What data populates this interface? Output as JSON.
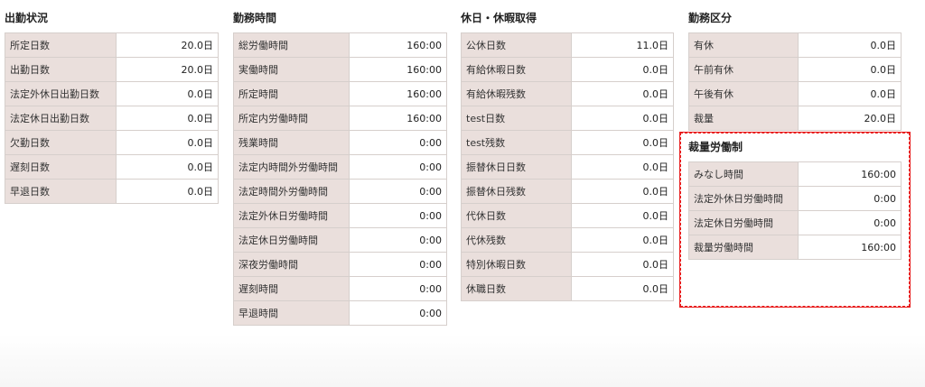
{
  "attendance": {
    "title": "出勤状況",
    "rows": [
      {
        "label": "所定日数",
        "value": "20.0日"
      },
      {
        "label": "出勤日数",
        "value": "20.0日"
      },
      {
        "label": "法定外休日出勤日数",
        "value": "0.0日"
      },
      {
        "label": "法定休日出勤日数",
        "value": "0.0日"
      },
      {
        "label": "欠勤日数",
        "value": "0.0日"
      },
      {
        "label": "遅刻日数",
        "value": "0.0日"
      },
      {
        "label": "早退日数",
        "value": "0.0日"
      }
    ]
  },
  "work_hours": {
    "title": "勤務時間",
    "rows": [
      {
        "label": "総労働時間",
        "value": "160:00"
      },
      {
        "label": "実働時間",
        "value": "160:00"
      },
      {
        "label": "所定時間",
        "value": "160:00"
      },
      {
        "label": "所定内労働時間",
        "value": "160:00"
      },
      {
        "label": "残業時間",
        "value": "0:00"
      },
      {
        "label": "法定内時間外労働時間",
        "value": "0:00"
      },
      {
        "label": "法定時間外労働時間",
        "value": "0:00"
      },
      {
        "label": "法定外休日労働時間",
        "value": "0:00"
      },
      {
        "label": "法定休日労働時間",
        "value": "0:00"
      },
      {
        "label": "深夜労働時間",
        "value": "0:00"
      },
      {
        "label": "遅刻時間",
        "value": "0:00"
      },
      {
        "label": "早退時間",
        "value": "0:00"
      }
    ]
  },
  "leave": {
    "title": "休日・休暇取得",
    "rows": [
      {
        "label": "公休日数",
        "value": "11.0日"
      },
      {
        "label": "有給休暇日数",
        "value": "0.0日"
      },
      {
        "label": "有給休暇残数",
        "value": "0.0日"
      },
      {
        "label": "test日数",
        "value": "0.0日"
      },
      {
        "label": "test残数",
        "value": "0.0日"
      },
      {
        "label": "振替休日日数",
        "value": "0.0日"
      },
      {
        "label": "振替休日残数",
        "value": "0.0日"
      },
      {
        "label": "代休日数",
        "value": "0.0日"
      },
      {
        "label": "代休残数",
        "value": "0.0日"
      },
      {
        "label": "特別休暇日数",
        "value": "0.0日"
      },
      {
        "label": "休職日数",
        "value": "0.0日"
      }
    ]
  },
  "work_category": {
    "title": "勤務区分",
    "rows": [
      {
        "label": "有休",
        "value": "0.0日"
      },
      {
        "label": "午前有休",
        "value": "0.0日"
      },
      {
        "label": "午後有休",
        "value": "0.0日"
      },
      {
        "label": "裁量",
        "value": "20.0日"
      }
    ]
  },
  "discretionary": {
    "title": "裁量労働制",
    "highlight_color": "#e81e1e",
    "rows": [
      {
        "label": "みなし時間",
        "value": "160:00"
      },
      {
        "label": "法定外休日労働時間",
        "value": "0:00"
      },
      {
        "label": "法定休日労働時間",
        "value": "0:00"
      },
      {
        "label": "裁量労働時間",
        "value": "160:00"
      }
    ]
  }
}
